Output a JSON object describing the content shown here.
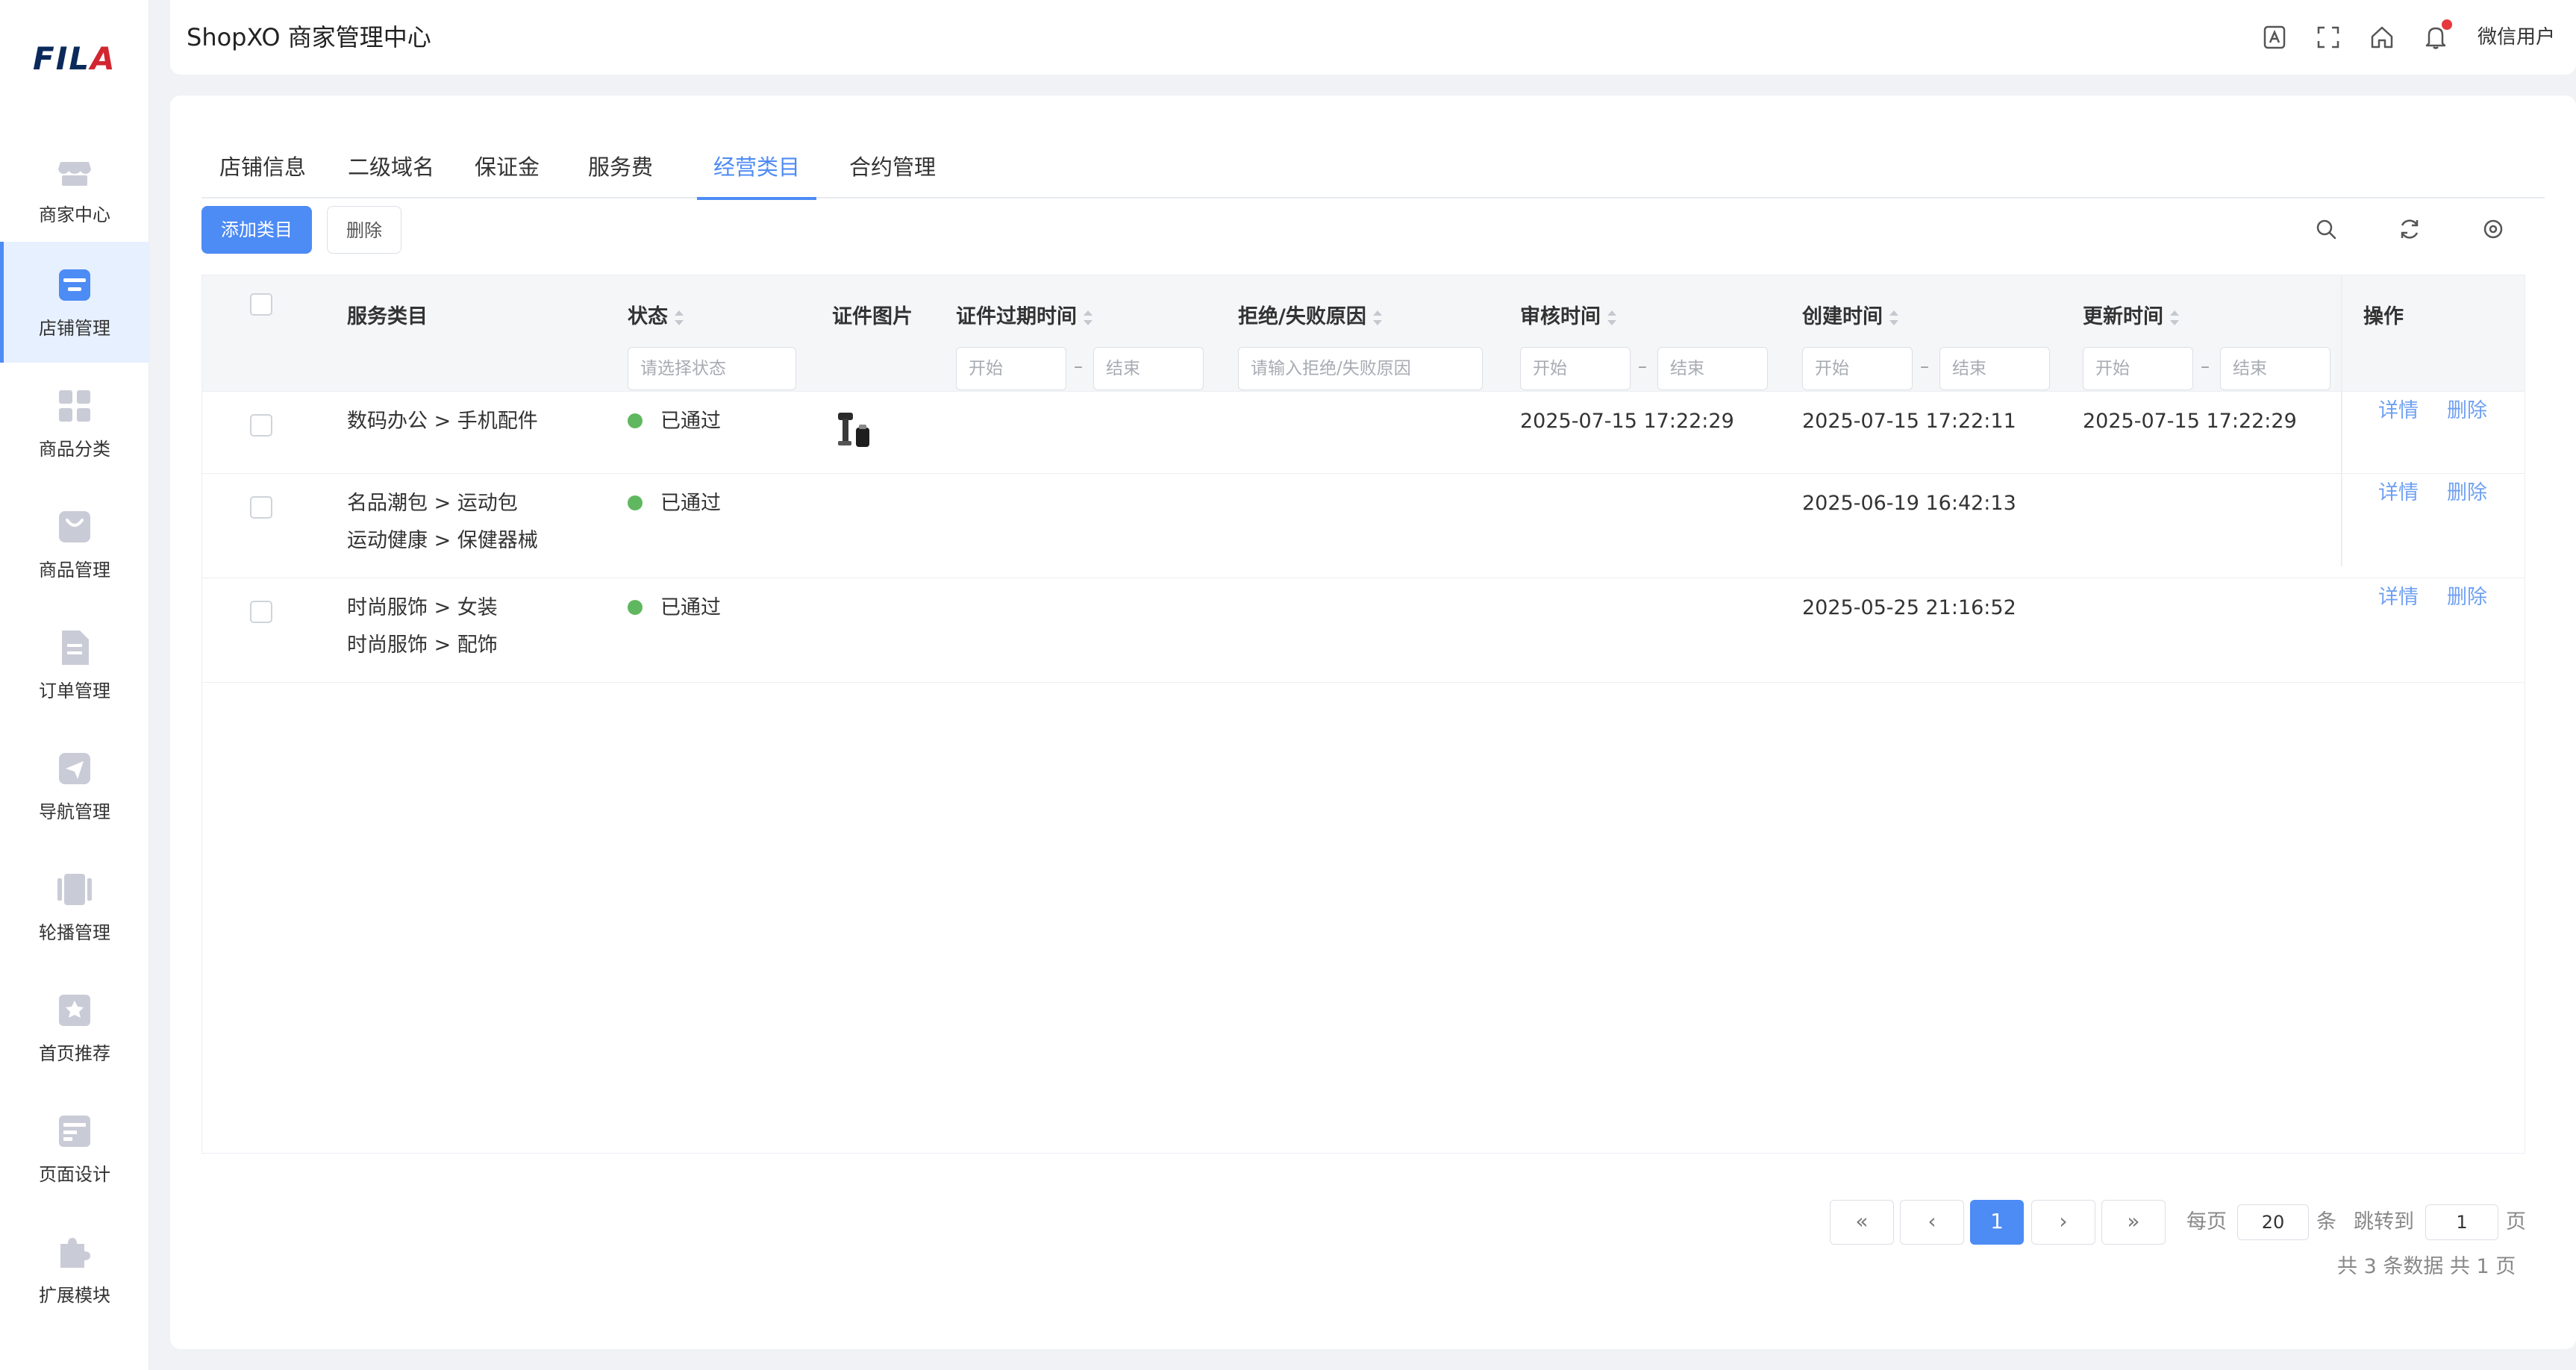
{
  "brand": {
    "logo_text": "FILA"
  },
  "sidebar": {
    "items": [
      {
        "label": "商家中心",
        "icon": "shop-icon"
      },
      {
        "label": "店铺管理",
        "icon": "store-icon",
        "active": true
      },
      {
        "label": "商品分类",
        "icon": "grid-icon"
      },
      {
        "label": "商品管理",
        "icon": "bag-icon"
      },
      {
        "label": "订单管理",
        "icon": "document-icon"
      },
      {
        "label": "导航管理",
        "icon": "send-icon"
      },
      {
        "label": "轮播管理",
        "icon": "carousel-icon"
      },
      {
        "label": "首页推荐",
        "icon": "star-bookmark-icon"
      },
      {
        "label": "页面设计",
        "icon": "layout-icon"
      },
      {
        "label": "扩展模块",
        "icon": "puzzle-icon"
      }
    ]
  },
  "header": {
    "title": "ShopXO 商家管理中心",
    "user_name": "微信用户"
  },
  "tabs": [
    {
      "label": "店铺信息"
    },
    {
      "label": "二级域名"
    },
    {
      "label": "保证金"
    },
    {
      "label": "服务费"
    },
    {
      "label": "经营类目",
      "active": true
    },
    {
      "label": "合约管理"
    }
  ],
  "toolbar": {
    "add_label": "添加类目",
    "delete_label": "删除"
  },
  "table": {
    "columns": {
      "category": "服务类目",
      "status": "状态",
      "cert_image": "证件图片",
      "cert_expire": "证件过期时间",
      "reject_reason": "拒绝/失败原因",
      "audit_time": "审核时间",
      "create_time": "创建时间",
      "update_time": "更新时间",
      "actions": "操作"
    },
    "filters": {
      "status_placeholder": "请选择状态",
      "start": "开始",
      "end": "结束",
      "dash": "–",
      "reason_placeholder": "请输入拒绝/失败原因"
    },
    "rows": [
      {
        "category_1": "数码办公 > 手机配件",
        "category_2": "",
        "status": "已通过",
        "audit_time": "2025-07-15 17:22:29",
        "create_time": "2025-07-15 17:22:11",
        "update_time": "2025-07-15 17:22:29",
        "detail": "详情",
        "delete": "删除"
      },
      {
        "category_1": "名品潮包 > 运动包",
        "category_2": "运动健康 > 保健器械",
        "status": "已通过",
        "audit_time": "",
        "create_time": "2025-06-19 16:42:13",
        "update_time": "",
        "detail": "详情",
        "delete": "删除"
      },
      {
        "category_1": "时尚服饰 > 女装",
        "category_2": "时尚服饰 > 配饰",
        "status": "已通过",
        "audit_time": "",
        "create_time": "2025-05-25 21:16:52",
        "update_time": "",
        "detail": "详情",
        "delete": "删除"
      }
    ]
  },
  "pagination": {
    "first": "«",
    "prev": "‹",
    "current": "1",
    "next": "›",
    "last": "»",
    "per_page_label": "每页",
    "per_page_value": "20",
    "per_page_unit": "条",
    "jump_label": "跳转到",
    "jump_value": "1",
    "jump_unit": "页",
    "summary": "共 3 条数据   共 1 页"
  },
  "colors": {
    "accent": "#4d8bf5",
    "status_ok": "#5fb85f",
    "notification": "#e6393d"
  }
}
